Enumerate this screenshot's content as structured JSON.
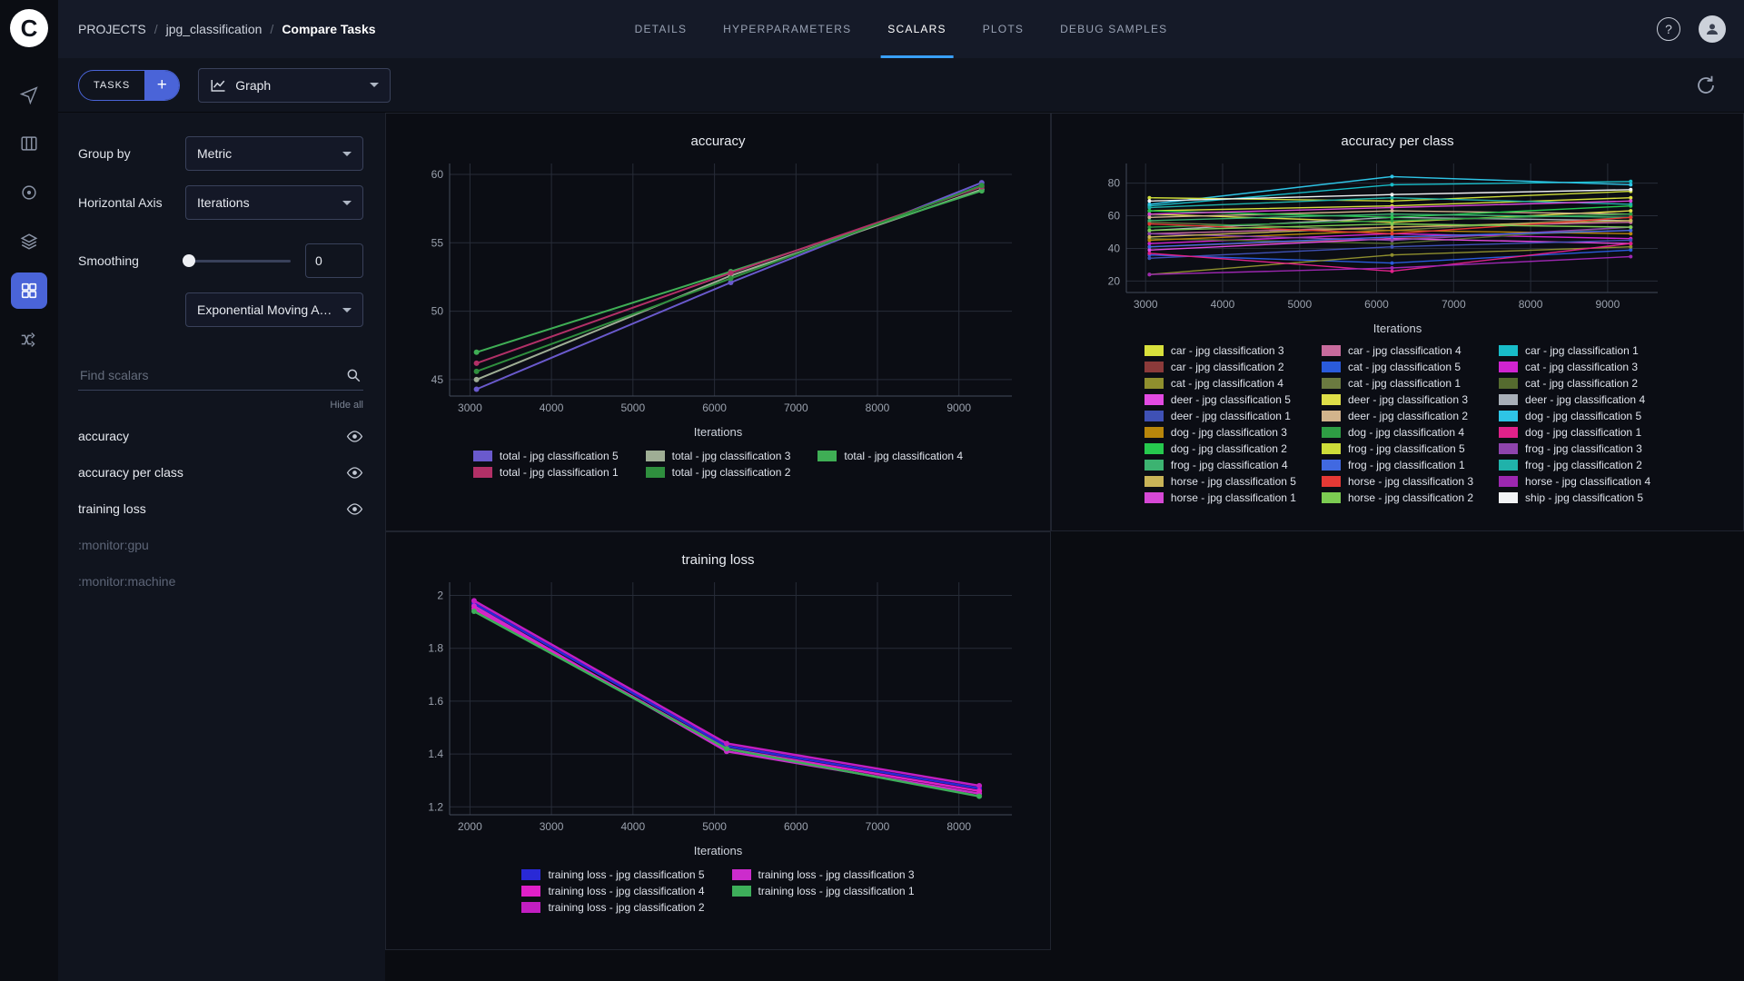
{
  "header": {
    "logo_letter": "C",
    "breadcrumb": {
      "root": "PROJECTS",
      "project": "jpg_classification",
      "page": "Compare Tasks",
      "separator": "/"
    },
    "tabs": [
      {
        "label": "DETAILS",
        "active": false
      },
      {
        "label": "HYPERPARAMETERS",
        "active": false
      },
      {
        "label": "SCALARS",
        "active": true
      },
      {
        "label": "PLOTS",
        "active": false
      },
      {
        "label": "DEBUG SAMPLES",
        "active": false
      }
    ],
    "help_icon": "?",
    "tab_accent_color": "#39a0ff"
  },
  "toolbar": {
    "tasks_button": "TASKS",
    "add_button": "+",
    "view_dropdown": "Graph"
  },
  "sidebar": {
    "icons": [
      "projects-icon",
      "datasets-icon",
      "pipelines-icon",
      "reports-icon",
      "applications-icon",
      "orchestration-icon"
    ],
    "active_icon": "applications-icon",
    "active_color": "#4a64d8"
  },
  "settings": {
    "group_by_label": "Group by",
    "group_by_value": "Metric",
    "horizontal_axis_label": "Horizontal Axis",
    "horizontal_axis_value": "Iterations",
    "smoothing_label": "Smoothing",
    "smoothing_value": "0",
    "smoothing_method": "Exponential Moving Av...",
    "search_placeholder": "Find scalars",
    "hide_all_label": "Hide all",
    "metrics": [
      {
        "label": "accuracy",
        "enabled": true
      },
      {
        "label": "accuracy per class",
        "enabled": true
      },
      {
        "label": "training loss",
        "enabled": true
      },
      {
        "label": ":monitor:gpu",
        "enabled": false
      },
      {
        "label": ":monitor:machine",
        "enabled": false
      }
    ]
  },
  "chart_data": [
    {
      "id": "accuracy",
      "type": "line",
      "title": "accuracy",
      "xlabel": "Iterations",
      "x_range": [
        2750,
        9650
      ],
      "y_range": [
        43.8,
        60.8
      ],
      "x_ticks": [
        3000,
        4000,
        5000,
        6000,
        7000,
        8000,
        9000
      ],
      "y_ticks": [
        45,
        50,
        55,
        60
      ],
      "x_points": [
        3080,
        6200,
        9280
      ],
      "markers": true,
      "marker_size": 3,
      "line_width": 2,
      "legend_columns": 3,
      "series": [
        {
          "name": "total - jpg classification 5",
          "color": "#6a5acd",
          "values": [
            44.3,
            52.1,
            59.4
          ]
        },
        {
          "name": "total - jpg classification 3",
          "color": "#9fae95",
          "values": [
            45.0,
            52.6,
            58.9
          ]
        },
        {
          "name": "total - jpg classification 4",
          "color": "#3fae55",
          "values": [
            47.0,
            52.9,
            58.8
          ]
        },
        {
          "name": "total - jpg classification 1",
          "color": "#b23067",
          "values": [
            46.2,
            52.8,
            59.1
          ]
        },
        {
          "name": "total - jpg classification 2",
          "color": "#2f8f3e",
          "values": [
            45.6,
            52.4,
            59.2
          ]
        }
      ]
    },
    {
      "id": "accuracy-per-class",
      "type": "line",
      "title": "accuracy per class",
      "xlabel": "Iterations",
      "x_range": [
        2750,
        9650
      ],
      "y_range": [
        13,
        92
      ],
      "x_ticks": [
        3000,
        4000,
        5000,
        6000,
        7000,
        8000,
        9000
      ],
      "y_ticks": [
        20,
        40,
        60,
        80
      ],
      "x_points": [
        3050,
        6200,
        9300
      ],
      "markers": true,
      "marker_size": 2,
      "line_width": 1.4,
      "legend_columns": 3,
      "legend_truncated": true,
      "series": [
        {
          "name": "car - jpg classification 3",
          "color": "#d8e03c",
          "values": [
            63,
            66,
            71
          ]
        },
        {
          "name": "car - jpg classification 4",
          "color": "#c86b9d",
          "values": [
            49,
            53,
            56
          ]
        },
        {
          "name": "car - jpg classification 1",
          "color": "#18bcc8",
          "values": [
            66,
            79,
            81
          ]
        },
        {
          "name": "car - jpg classification 2",
          "color": "#8b3a3a",
          "values": [
            41,
            46,
            51
          ]
        },
        {
          "name": "cat - jpg classification 5",
          "color": "#2a5bdc",
          "values": [
            36,
            31,
            39
          ]
        },
        {
          "name": "cat - jpg classification 3",
          "color": "#d024d0",
          "values": [
            43,
            49,
            46
          ]
        },
        {
          "name": "cat - jpg classification 4",
          "color": "#8f8f2e",
          "values": [
            24,
            36,
            41
          ]
        },
        {
          "name": "cat - jpg classification 1",
          "color": "#6b7a40",
          "values": [
            56,
            51,
            59
          ]
        },
        {
          "name": "cat - jpg classification 2",
          "color": "#556b2f",
          "values": [
            46,
            43,
            53
          ]
        },
        {
          "name": "deer - jpg classification 5",
          "color": "#e24ae2",
          "values": [
            39,
            46,
            43
          ]
        },
        {
          "name": "deer - jpg classification 3",
          "color": "#dede48",
          "values": [
            61,
            56,
            63
          ]
        },
        {
          "name": "deer - jpg classification 4",
          "color": "#a8afb8",
          "values": [
            51,
            59,
            57
          ]
        },
        {
          "name": "deer - jpg classification 1",
          "color": "#3f51b5",
          "values": [
            34,
            41,
            45
          ]
        },
        {
          "name": "deer - jpg classification 2",
          "color": "#d2b48c",
          "values": [
            59,
            63,
            61
          ]
        },
        {
          "name": "dog - jpg classification 5",
          "color": "#2ec4e6",
          "values": [
            67,
            84,
            79
          ]
        },
        {
          "name": "dog - jpg classification 3",
          "color": "#b8860b",
          "values": [
            45,
            51,
            49
          ]
        },
        {
          "name": "dog - jpg classification 4",
          "color": "#2e9e44",
          "values": [
            53,
            57,
            61
          ]
        },
        {
          "name": "dog - jpg classification 1",
          "color": "#e0218a",
          "values": [
            37,
            26,
            43
          ]
        },
        {
          "name": "dog - jpg classification 2",
          "color": "#26c94e",
          "values": [
            63,
            59,
            66
          ]
        },
        {
          "name": "frog - jpg classification 5",
          "color": "#cddc39",
          "values": [
            71,
            69,
            75
          ]
        },
        {
          "name": "frog - jpg classification 3",
          "color": "#8e44ad",
          "values": [
            49,
            45,
            53
          ]
        },
        {
          "name": "frog - jpg classification 4",
          "color": "#3cb371",
          "values": [
            57,
            61,
            59
          ]
        },
        {
          "name": "frog - jpg classification 1",
          "color": "#4169e1",
          "values": [
            41,
            47,
            51
          ]
        },
        {
          "name": "frog - jpg classification 2",
          "color": "#20b2aa",
          "values": [
            65,
            71,
            67
          ]
        },
        {
          "name": "horse - jpg classification 5",
          "color": "#c9b458",
          "values": [
            47,
            53,
            57
          ]
        },
        {
          "name": "horse - jpg classification 3",
          "color": "#e53935",
          "values": [
            55,
            49,
            59
          ]
        },
        {
          "name": "horse - jpg classification 4",
          "color": "#9c27b0",
          "values": [
            24,
            28,
            35
          ]
        },
        {
          "name": "horse - jpg classification 1",
          "color": "#d648d6",
          "values": [
            61,
            65,
            69
          ]
        },
        {
          "name": "horse - jpg classification 2",
          "color": "#7ccc52",
          "values": [
            51,
            55,
            53
          ]
        },
        {
          "name": "ship - jpg classification 5",
          "color": "#f2f3f5",
          "values": [
            69,
            73,
            76
          ]
        }
      ]
    },
    {
      "id": "training-loss",
      "type": "line",
      "title": "training loss",
      "xlabel": "Iterations",
      "x_range": [
        1750,
        8650
      ],
      "y_range": [
        1.17,
        2.05
      ],
      "x_ticks": [
        2000,
        3000,
        4000,
        5000,
        6000,
        7000,
        8000
      ],
      "y_ticks": [
        1.2,
        1.4,
        1.6,
        1.8,
        2
      ],
      "x_points": [
        2050,
        5150,
        8250
      ],
      "markers": true,
      "marker_size": 3,
      "line_width": 2.5,
      "legend_columns": 2,
      "series": [
        {
          "name": "training loss - jpg classification 5",
          "color": "#2929d6",
          "values": [
            1.97,
            1.43,
            1.27
          ]
        },
        {
          "name": "training loss - jpg classification 3",
          "color": "#cc2ccc",
          "values": [
            1.96,
            1.41,
            1.25
          ]
        },
        {
          "name": "training loss - jpg classification 4",
          "color": "#e020c8",
          "values": [
            1.95,
            1.42,
            1.26
          ]
        },
        {
          "name": "training loss - jpg classification 1",
          "color": "#3dae5a",
          "values": [
            1.94,
            1.42,
            1.24
          ]
        },
        {
          "name": "training loss - jpg classification 2",
          "color": "#c21ec2",
          "values": [
            1.98,
            1.44,
            1.28
          ]
        }
      ]
    }
  ]
}
